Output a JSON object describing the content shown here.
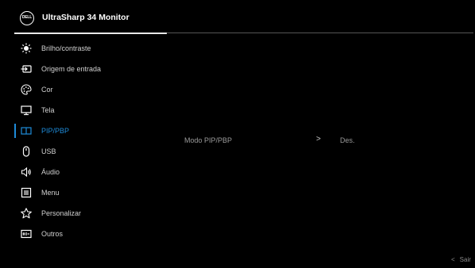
{
  "header": {
    "brand": "DELL",
    "model": "UltraSharp 34 Monitor"
  },
  "menu": {
    "items": [
      {
        "label": "Brilho/contraste",
        "icon": "brightness-icon"
      },
      {
        "label": "Origem de entrada",
        "icon": "input-source-icon"
      },
      {
        "label": "Cor",
        "icon": "color-palette-icon"
      },
      {
        "label": "Tela",
        "icon": "display-icon"
      },
      {
        "label": "PIP/PBP",
        "icon": "pip-pbp-icon"
      },
      {
        "label": "USB",
        "icon": "mouse-icon"
      },
      {
        "label": "Áudio",
        "icon": "speaker-icon"
      },
      {
        "label": "Menu",
        "icon": "menu-list-icon"
      },
      {
        "label": "Personalizar",
        "icon": "star-icon"
      },
      {
        "label": "Outros",
        "icon": "others-icon"
      }
    ],
    "active_index": 4
  },
  "submenu": {
    "label": "Modo PIP/PBP",
    "chevron": ">",
    "value": "Des."
  },
  "footer": {
    "exit_chevron": "<",
    "exit_label": "Sair"
  },
  "colors": {
    "accent": "#1e8bd8",
    "background": "#000000"
  }
}
